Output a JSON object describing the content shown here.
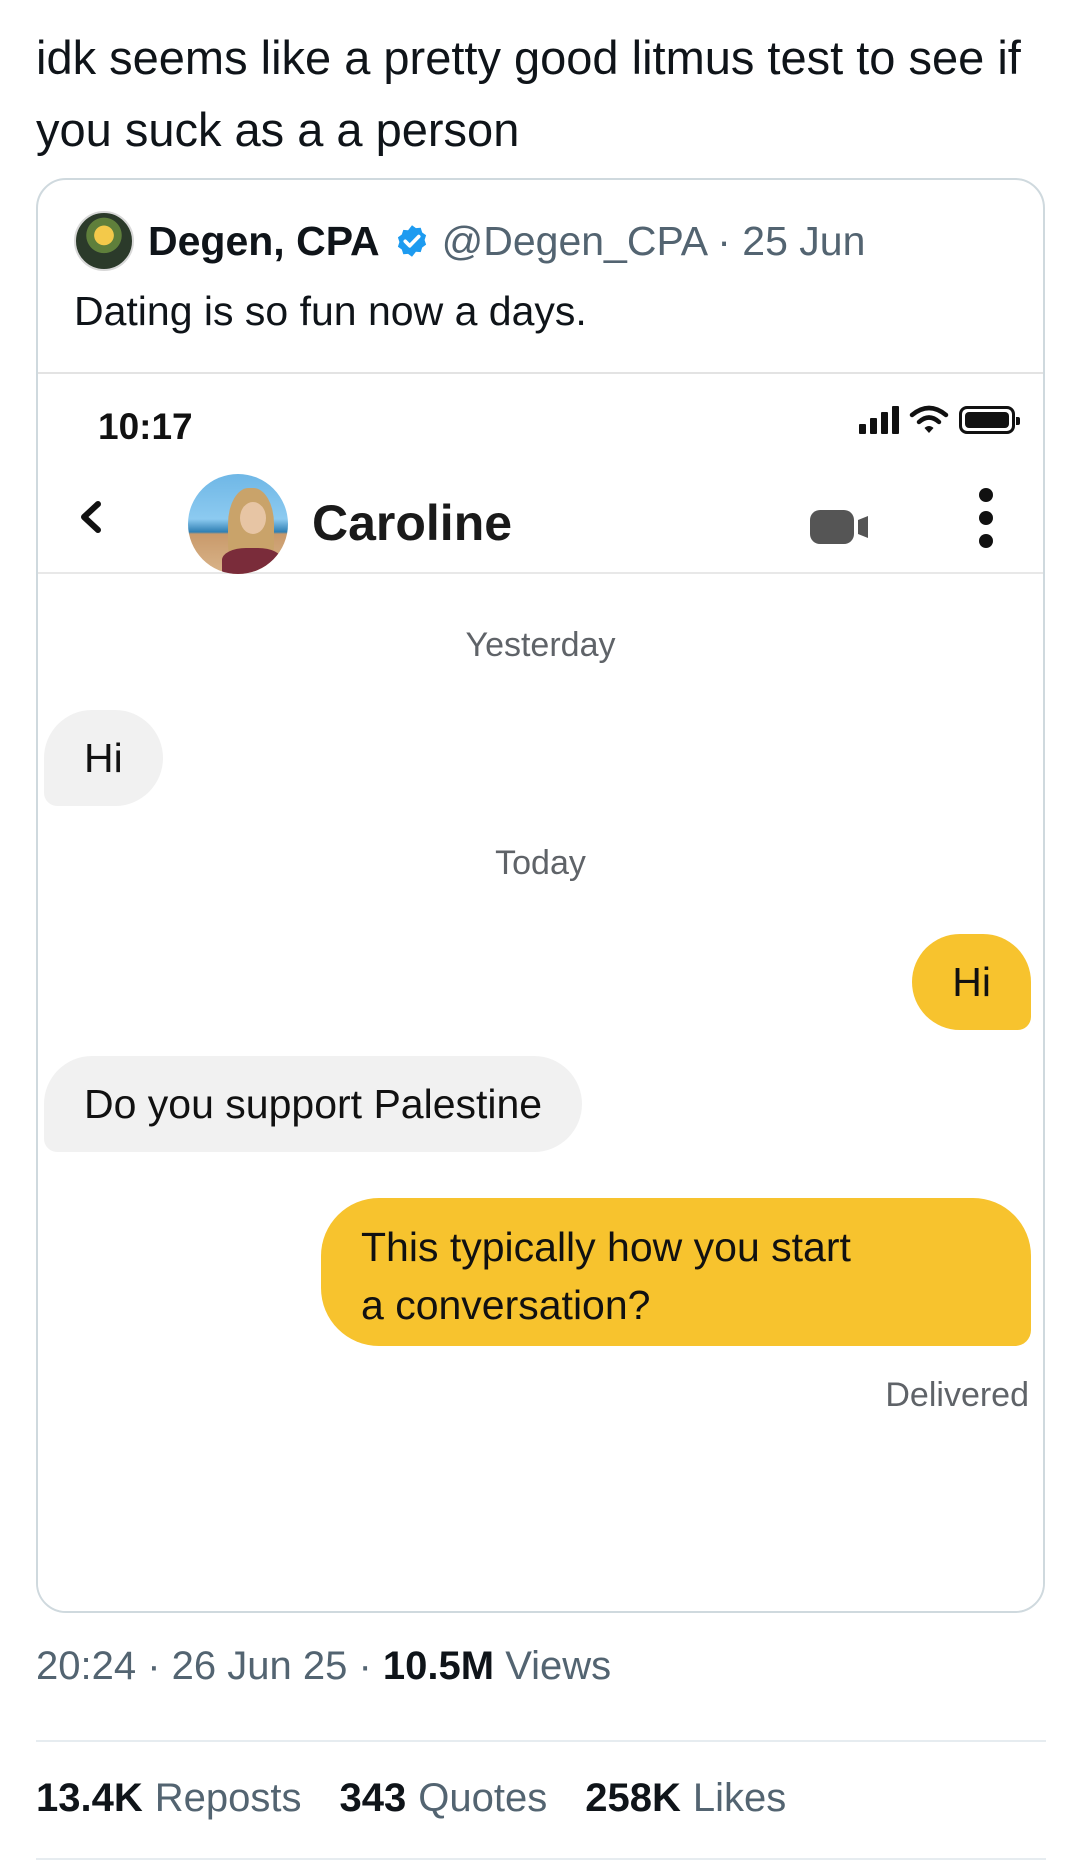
{
  "tweet": {
    "text": "idk seems like a pretty good litmus test to see if you suck as a a person",
    "timestamp": "20:24 · 26 Jun 25 ·",
    "views_count": "10.5M",
    "views_label": "Views",
    "stats": {
      "reposts_count": "13.4K",
      "reposts_label": "Reposts",
      "quotes_count": "343",
      "quotes_label": "Quotes",
      "likes_count": "258K",
      "likes_label": "Likes"
    }
  },
  "quoted": {
    "author_name": "Degen, CPA",
    "handle_date": "@Degen_CPA · 25 Jun",
    "text": "Dating is so fun now a days.",
    "verified_color": "#1d9bf0"
  },
  "screenshot": {
    "status_time": "10:17",
    "contact_name": "Caroline",
    "messages": {
      "day1": "Yesterday",
      "m1": "Hi",
      "day2": "Today",
      "m2": "Hi",
      "m3": "Do you support Palestine",
      "m4_line1": "This typically how you start",
      "m4_line2": "a conversation?",
      "status": "Delivered"
    },
    "icons": [
      "back-chevron-icon",
      "video-call-icon",
      "more-vertical-icon",
      "signal-icon",
      "wifi-icon",
      "battery-icon"
    ],
    "colors": {
      "sent_bubble": "#f7c32e",
      "received_bubble": "#f1f1f1"
    }
  }
}
